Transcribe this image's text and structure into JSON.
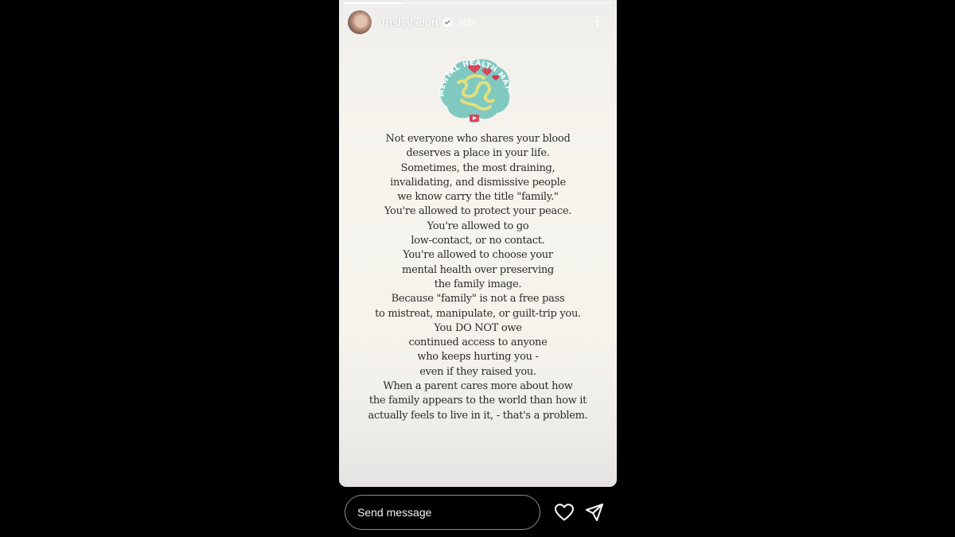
{
  "story": {
    "progress": 0.22,
    "username": "trishaladutt",
    "verified": true,
    "timestamp": "20h",
    "more_icon": "more-vertical-icon",
    "logo": {
      "text": "MENTAL HEALTH MATTERS",
      "colors": {
        "brain": "#7fc9c1",
        "maze": "#e1e07d",
        "heart": "#d8475a"
      }
    },
    "quote_lines": [
      "Not everyone who shares your blood",
      "deserves a place in your life.",
      "Sometimes, the most draining,",
      "invalidating, and dismissive people",
      "we know carry the title \"family.\"",
      "You're allowed to protect your peace.",
      "You're allowed to go",
      "low-contact, or no contact.",
      "You're allowed to choose your",
      "mental health over preserving",
      "the family image.",
      "Because \"family\" is not a free pass",
      "to mistreat, manipulate, or guilt-trip you.",
      "You DO NOT owe",
      "continued access to anyone",
      "who keeps hurting you -",
      "even if they raised you.",
      "When a parent cares more about how",
      "the family appears to the world than how it",
      "actually feels to live in it, - that's a problem."
    ]
  },
  "reply": {
    "placeholder": "Send message",
    "like_icon": "heart-icon",
    "share_icon": "send-icon"
  },
  "colors": {
    "background": "#000000",
    "story_bg": "#f6f3ed",
    "text": "#2c2a2a"
  }
}
